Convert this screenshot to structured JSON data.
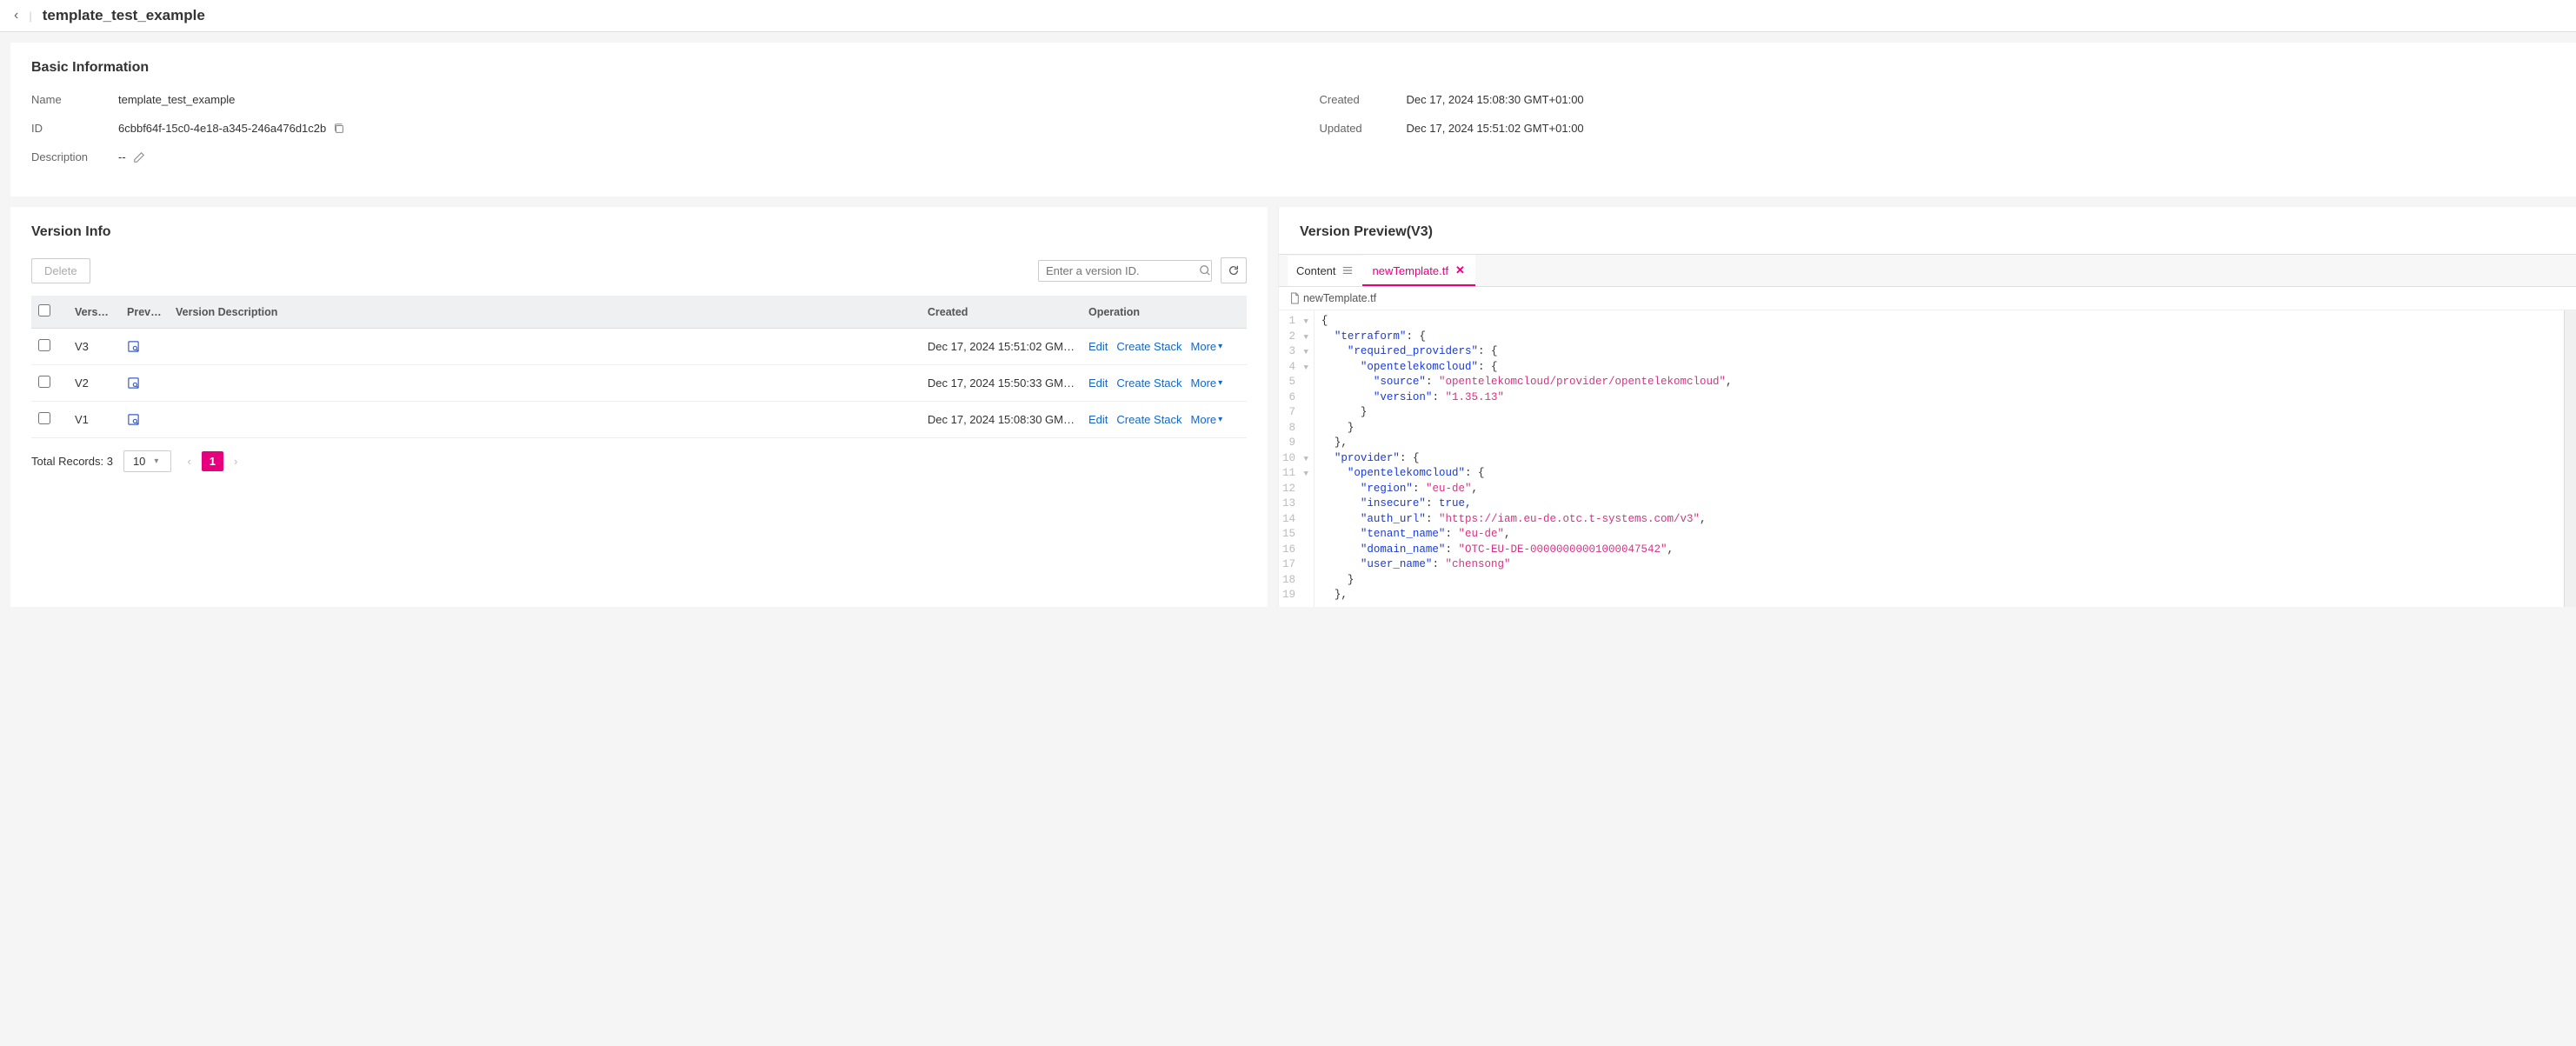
{
  "header": {
    "title": "template_test_example"
  },
  "basic": {
    "section_title": "Basic Information",
    "labels": {
      "name": "Name",
      "id": "ID",
      "description": "Description",
      "created": "Created",
      "updated": "Updated"
    },
    "name": "template_test_example",
    "id": "6cbbf64f-15c0-4e18-a345-246a476d1c2b",
    "description": "--",
    "created": "Dec 17, 2024 15:08:30 GMT+01:00",
    "updated": "Dec 17, 2024 15:51:02 GMT+01:00"
  },
  "version_info": {
    "title": "Version Info",
    "delete_label": "Delete",
    "search_placeholder": "Enter a version ID.",
    "columns": {
      "version": "Vers…",
      "preview": "Prev…",
      "desc": "Version Description",
      "created": "Created",
      "operation": "Operation"
    },
    "rows": [
      {
        "version": "V3",
        "created": "Dec 17, 2024 15:51:02 GM…"
      },
      {
        "version": "V2",
        "created": "Dec 17, 2024 15:50:33 GM…"
      },
      {
        "version": "V1",
        "created": "Dec 17, 2024 15:08:30 GM…"
      }
    ],
    "ops": {
      "edit": "Edit",
      "create_stack": "Create Stack",
      "more": "More"
    },
    "pager": {
      "total_label": "Total Records: 3",
      "page_size": "10",
      "current": "1"
    }
  },
  "preview": {
    "title": "Version Preview(V3)",
    "content_label": "Content",
    "file_tab": "newTemplate.tf",
    "file_path": "newTemplate.tf",
    "code_lines": [
      "{",
      "  \"terraform\": {",
      "    \"required_providers\": {",
      "      \"opentelekomcloud\": {",
      "        \"source\": \"opentelekomcloud/provider/opentelekomcloud\",",
      "        \"version\": \"1.35.13\"",
      "      }",
      "    }",
      "  },",
      "  \"provider\": {",
      "    \"opentelekomcloud\": {",
      "      \"region\": \"eu-de\",",
      "      \"insecure\": true,",
      "      \"auth_url\": \"https://iam.eu-de.otc.t-systems.com/v3\",",
      "      \"tenant_name\": \"eu-de\",",
      "      \"domain_name\": \"OTC-EU-DE-00000000001000047542\",",
      "      \"user_name\": \"chensong\"",
      "    }",
      "  },"
    ],
    "fold_lines": [
      1,
      2,
      3,
      4,
      10,
      11
    ]
  }
}
